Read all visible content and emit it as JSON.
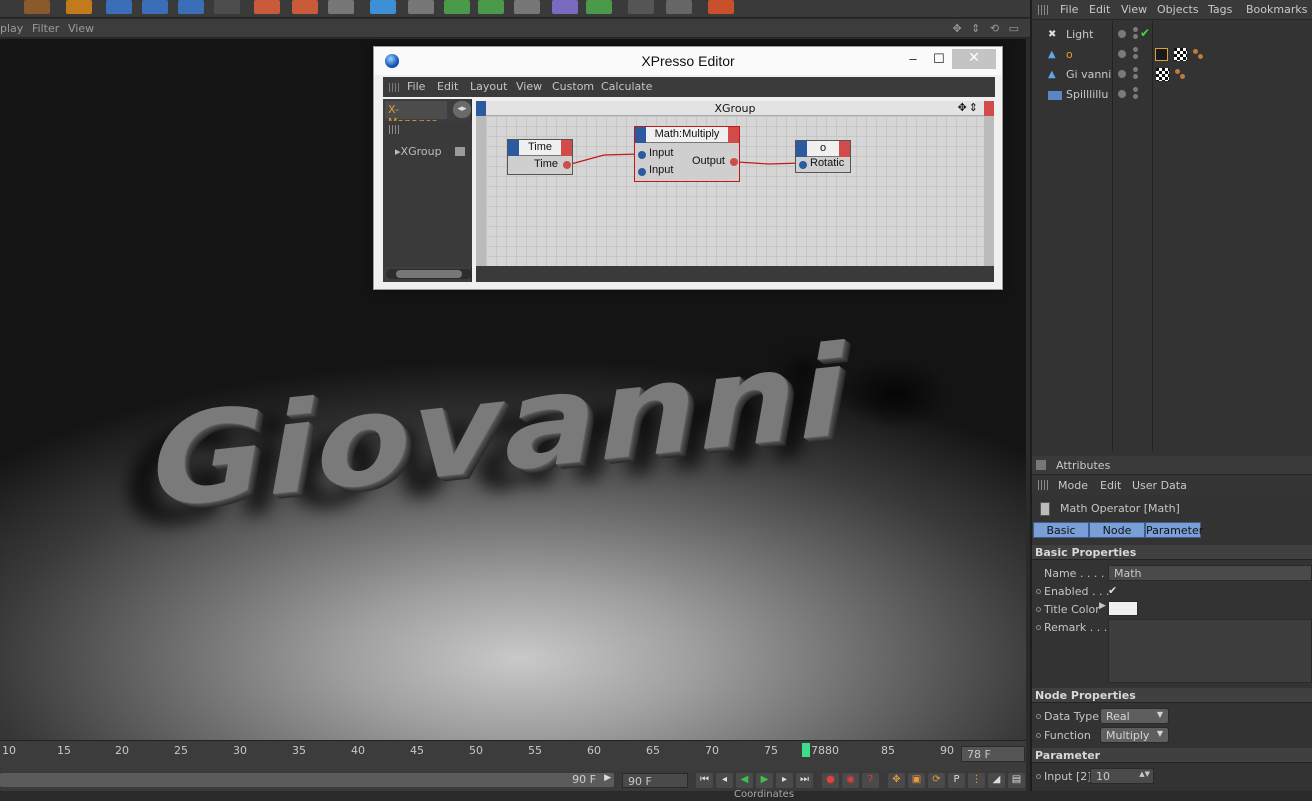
{
  "viewport": {
    "menu": [
      "play",
      "Filter",
      "View"
    ],
    "nav_icons": "✥ ⇕ ⟲ ▭",
    "scene_text": "Giovanni"
  },
  "xpresso": {
    "title": "XPresso Editor",
    "window_buttons": {
      "minimize": "–",
      "maximize": "☐",
      "close": "✕"
    },
    "menu": [
      "File",
      "Edit",
      "Layout",
      "View",
      "Custom",
      "Calculate"
    ],
    "xmanager_tab": "X-Manager",
    "tree_item": "XGroup",
    "group_title": "XGroup",
    "nodes": {
      "time": {
        "title": "Time",
        "out_port": "Time"
      },
      "math": {
        "title": "Math:Multiply",
        "in1": "Input",
        "in2": "Input",
        "out_port": "Output"
      },
      "target": {
        "title": "o",
        "in_port": "Rotatic"
      }
    }
  },
  "object_manager": {
    "menu": [
      "File",
      "Edit",
      "View",
      "Objects",
      "Tags",
      "Bookmarks"
    ],
    "objects": [
      {
        "name": "Light",
        "icon": "light-icon"
      },
      {
        "name": "o",
        "icon": "text-spline-icon"
      },
      {
        "name": "Gi vanni",
        "icon": "text-spline-icon"
      },
      {
        "name": "Spilllillu",
        "icon": "plane-icon"
      }
    ]
  },
  "attributes": {
    "header": "Attributes",
    "menu": [
      "Mode",
      "Edit",
      "User Data"
    ],
    "object_title": "Math Operator [Math]",
    "tabs": [
      "Basic",
      "Node",
      "Parameter"
    ],
    "basic_section": "Basic Properties",
    "name_label": "Name . . . . .",
    "name_value": "Math",
    "enabled_label": "Enabled . . .",
    "enabled_value": "✔",
    "title_color_label": "Title Color",
    "remark_label": "Remark . . .",
    "node_section": "Node Properties",
    "data_type_label": "Data Type",
    "data_type_value": "Real",
    "function_label": "Function",
    "function_value": "Multiply",
    "param_section": "Parameter",
    "input_label": "Input [2]",
    "input_value": "10"
  },
  "timeline": {
    "ticks": [
      "10",
      "15",
      "20",
      "25",
      "30",
      "35",
      "40",
      "45",
      "50",
      "55",
      "60",
      "65",
      "70",
      "75",
      "7880",
      "85",
      "90"
    ],
    "current_frame": "78 F",
    "range_end": "90 F",
    "max_frame": "90 F",
    "coordinates_tab": "Coordinates"
  },
  "colors": {
    "node_header_blue": "#2c5aa0",
    "node_port_red": "#d14b4b",
    "xmanager_orange": "#e89a3c",
    "tab_blue": "#7a9fd6",
    "frame_marker_green": "#3fdc8a"
  }
}
